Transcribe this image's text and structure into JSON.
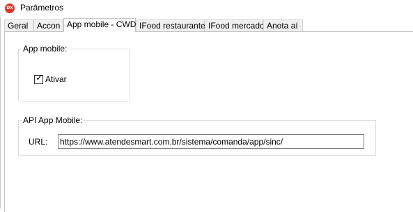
{
  "window": {
    "title": "Parâmetros",
    "icon_text": "DX"
  },
  "tabs": [
    {
      "label": "Geral"
    },
    {
      "label": "Accon"
    },
    {
      "label": "App mobile - CWD"
    },
    {
      "label": "IFood restaurante"
    },
    {
      "label": "IFood mercado"
    },
    {
      "label": "Anota aí"
    }
  ],
  "active_tab": "App mobile - CWD",
  "app_mobile_group": {
    "legend": "App mobile:",
    "checkbox_label": "Ativar",
    "checked": true
  },
  "api_group": {
    "legend": "API App Mobile:",
    "url_label": "URL:",
    "url_value": "https://www.atendesmart.com.br/sistema/comanda/app/sinc/"
  }
}
